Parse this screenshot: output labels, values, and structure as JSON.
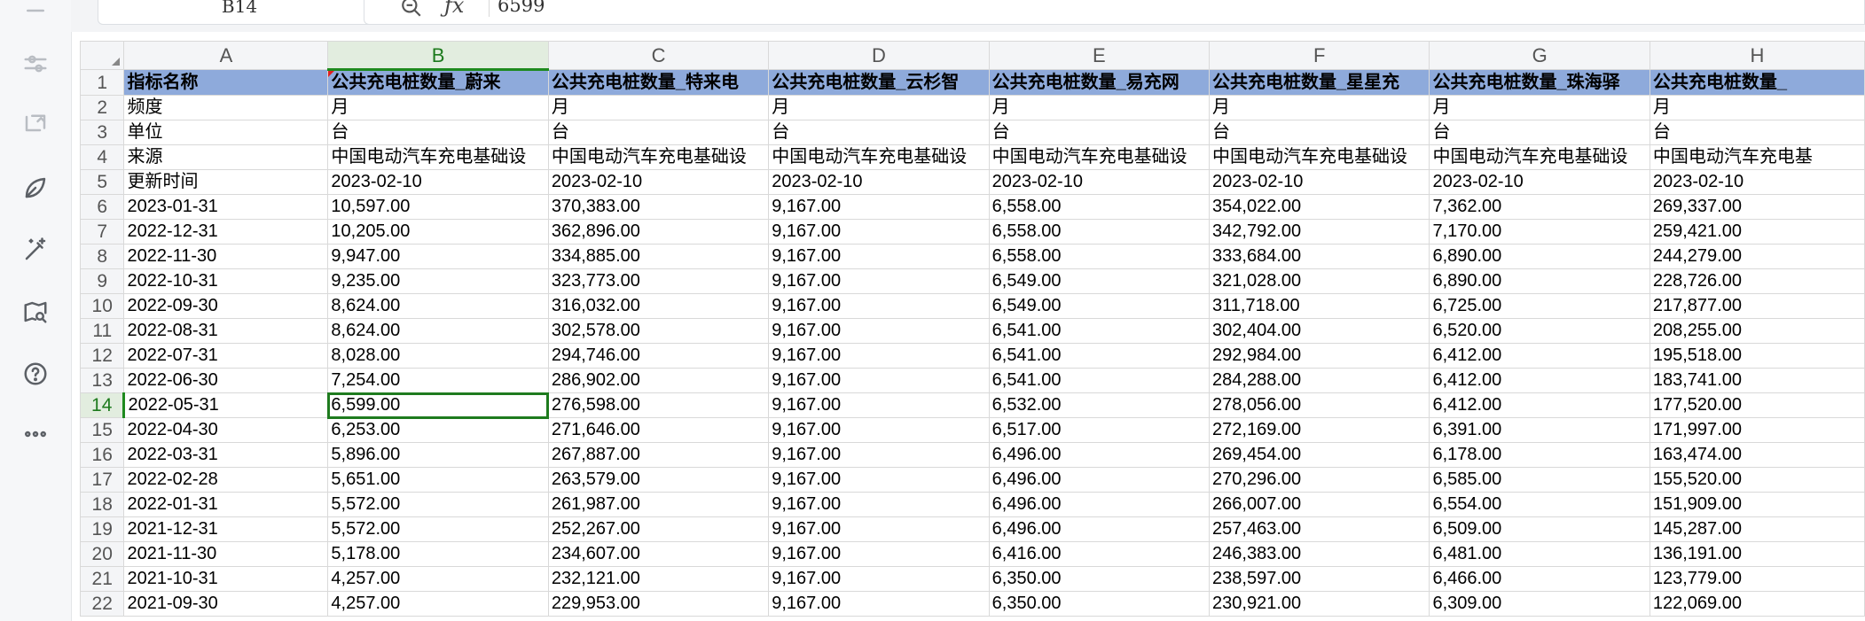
{
  "name_box": "B14",
  "formula_value": "6599",
  "icons": [
    "minus-icon",
    "sliders-icon",
    "sort-icon",
    "leaf-icon",
    "magic-wand-icon",
    "map-search-icon",
    "help-icon",
    "more-icon"
  ],
  "columns": [
    "A",
    "B",
    "C",
    "D",
    "E",
    "F",
    "G",
    "H"
  ],
  "header_row": [
    "指标名称",
    "公共充电桩数量_蔚来",
    "公共充电桩数量_特来电",
    "公共充电桩数量_云杉智",
    "公共充电桩数量_易充网",
    "公共充电桩数量_星星充",
    "公共充电桩数量_珠海驿",
    "公共充电桩数量_"
  ],
  "meta_rows": [
    [
      "频度",
      "月",
      "月",
      "月",
      "月",
      "月",
      "月",
      "月"
    ],
    [
      "单位",
      "台",
      "台",
      "台",
      "台",
      "台",
      "台",
      "台"
    ],
    [
      "来源",
      "中国电动汽车充电基础设",
      "中国电动汽车充电基础设",
      "中国电动汽车充电基础设",
      "中国电动汽车充电基础设",
      "中国电动汽车充电基础设",
      "中国电动汽车充电基础设",
      "中国电动汽车充电基"
    ],
    [
      "更新时间",
      "2023-02-10",
      "2023-02-10",
      "2023-02-10",
      "2023-02-10",
      "2023-02-10",
      "2023-02-10",
      "2023-02-10"
    ]
  ],
  "data_rows": [
    [
      "2023-01-31",
      "10,597.00",
      "370,383.00",
      "9,167.00",
      "6,558.00",
      "354,022.00",
      "7,362.00",
      "269,337.00"
    ],
    [
      "2022-12-31",
      "10,205.00",
      "362,896.00",
      "9,167.00",
      "6,558.00",
      "342,792.00",
      "7,170.00",
      "259,421.00"
    ],
    [
      "2022-11-30",
      "9,947.00",
      "334,885.00",
      "9,167.00",
      "6,558.00",
      "333,684.00",
      "6,890.00",
      "244,279.00"
    ],
    [
      "2022-10-31",
      "9,235.00",
      "323,773.00",
      "9,167.00",
      "6,549.00",
      "321,028.00",
      "6,890.00",
      "228,726.00"
    ],
    [
      "2022-09-30",
      "8,624.00",
      "316,032.00",
      "9,167.00",
      "6,549.00",
      "311,718.00",
      "6,725.00",
      "217,877.00"
    ],
    [
      "2022-08-31",
      "8,624.00",
      "302,578.00",
      "9,167.00",
      "6,541.00",
      "302,404.00",
      "6,520.00",
      "208,255.00"
    ],
    [
      "2022-07-31",
      "8,028.00",
      "294,746.00",
      "9,167.00",
      "6,541.00",
      "292,984.00",
      "6,412.00",
      "195,518.00"
    ],
    [
      "2022-06-30",
      "7,254.00",
      "286,902.00",
      "9,167.00",
      "6,541.00",
      "284,288.00",
      "6,412.00",
      "183,741.00"
    ],
    [
      "2022-05-31",
      "6,599.00",
      "276,598.00",
      "9,167.00",
      "6,532.00",
      "278,056.00",
      "6,412.00",
      "177,520.00"
    ],
    [
      "2022-04-30",
      "6,253.00",
      "271,646.00",
      "9,167.00",
      "6,517.00",
      "272,169.00",
      "6,391.00",
      "171,997.00"
    ],
    [
      "2022-03-31",
      "5,896.00",
      "267,887.00",
      "9,167.00",
      "6,496.00",
      "269,454.00",
      "6,178.00",
      "163,474.00"
    ],
    [
      "2022-02-28",
      "5,651.00",
      "263,579.00",
      "9,167.00",
      "6,496.00",
      "270,296.00",
      "6,585.00",
      "155,520.00"
    ],
    [
      "2022-01-31",
      "5,572.00",
      "261,987.00",
      "9,167.00",
      "6,496.00",
      "266,007.00",
      "6,554.00",
      "151,909.00"
    ],
    [
      "2021-12-31",
      "5,572.00",
      "252,267.00",
      "9,167.00",
      "6,496.00",
      "257,463.00",
      "6,509.00",
      "145,287.00"
    ],
    [
      "2021-11-30",
      "5,178.00",
      "234,607.00",
      "9,167.00",
      "6,416.00",
      "246,383.00",
      "6,481.00",
      "136,191.00"
    ],
    [
      "2021-10-31",
      "4,257.00",
      "232,121.00",
      "9,167.00",
      "6,350.00",
      "238,597.00",
      "6,466.00",
      "123,779.00"
    ],
    [
      "2021-09-30",
      "4,257.00",
      "229,953.00",
      "9,167.00",
      "6,350.00",
      "230,921.00",
      "6,309.00",
      "122,069.00"
    ]
  ]
}
